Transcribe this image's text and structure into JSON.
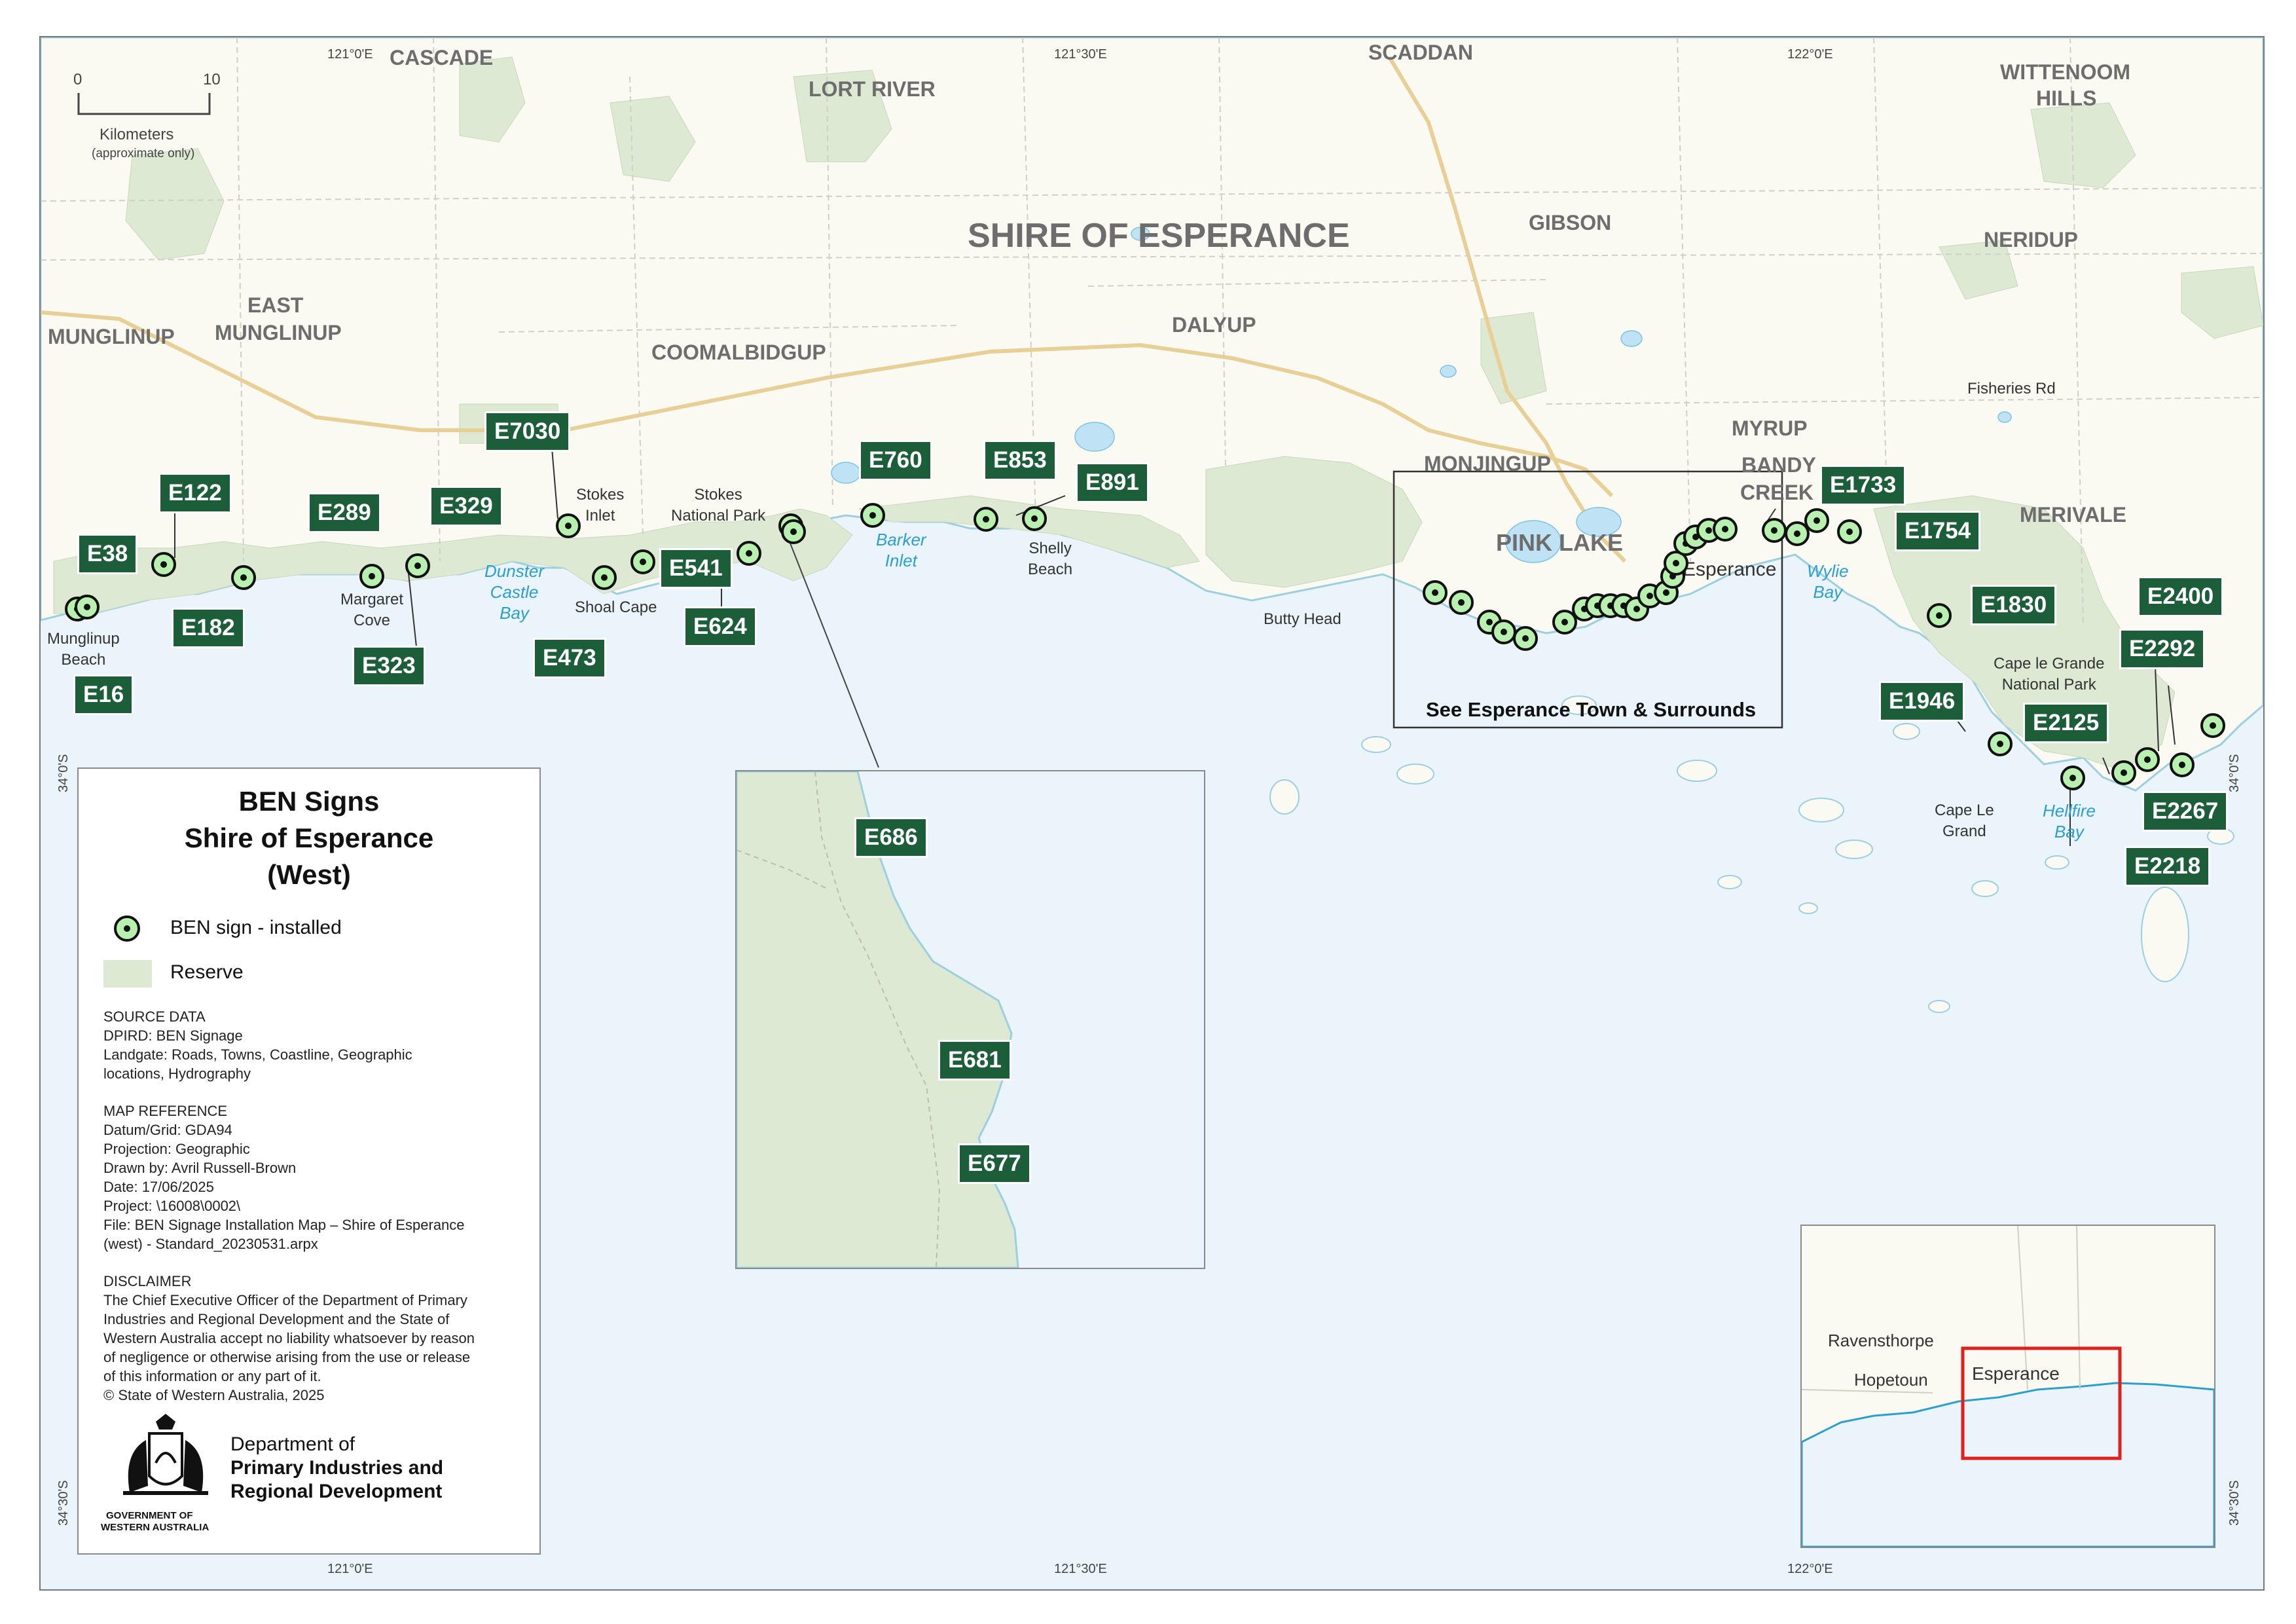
{
  "title": {
    "line1": "BEN Signs",
    "line2": "Shire of Esperance",
    "line3": "(West)"
  },
  "scale": {
    "zero": "0",
    "ten": "10",
    "unit": "Kilometers",
    "note": "(approximate only)"
  },
  "ticks": {
    "top": [
      "121°0'E",
      "121°30'E",
      "122°0'E"
    ],
    "bottom": [
      "121°0'E",
      "121°30'E",
      "122°0'E"
    ],
    "left": [
      "34°0'S",
      "34°30'S"
    ],
    "right": [
      "34°0'S",
      "34°30'S"
    ]
  },
  "legend": {
    "sign_label": "BEN sign - installed",
    "reserve_label": "Reserve",
    "source_heading": "SOURCE DATA",
    "source_lines": [
      "DPIRD: BEN Signage",
      "Landgate: Roads, Towns, Coastline, Geographic",
      "locations, Hydrography"
    ],
    "map_ref_heading": "MAP REFERENCE",
    "map_ref_lines": [
      "Datum/Grid: GDA94",
      "Projection:  Geographic",
      "Drawn by: Avril Russell-Brown",
      "Date: 17/06/2025",
      "Project: \\16008\\0002\\",
      "File: BEN Signage Installation Map – Shire of Esperance",
      "(west) - Standard_20230531.arpx"
    ],
    "disclaimer_heading": "DISCLAIMER",
    "disclaimer_lines": [
      "The Chief Executive Officer of the Department of Primary",
      "Industries and Regional Development and the State of",
      "Western Australia accept no liability whatsoever by reason",
      "of negligence or otherwise arising from the use or release",
      "of this information or any part of it.",
      "© State of Western Australia, 2025"
    ],
    "crest_line1": "GOVERNMENT OF",
    "crest_line2": "WESTERN AUSTRALIA",
    "dept_line1": "Department of",
    "dept_line2": "Primary Industries and",
    "dept_line3": "Regional Development"
  },
  "places": {
    "cascade": "CASCADE",
    "lort_river": "LORT RIVER",
    "scaddan": "SCADDAN",
    "wittenoom1": "WITTENOOM",
    "wittenoom2": "HILLS",
    "shire": "SHIRE OF ESPERANCE",
    "gibson": "GIBSON",
    "neridup": "NERIDUP",
    "east1": "EAST",
    "east2": "MUNGLINUP",
    "munglinup": "MUNGLINUP",
    "coomalbidgup": "COOMALBIDGUP",
    "dalyup": "DALYUP",
    "myrup": "MYRUP",
    "monjingup": "MONJINGUP",
    "bandy1": "BANDY",
    "bandy2": "CREEK",
    "merivale": "MERIVALE",
    "pink_lake": "PINK LAKE",
    "fisheries": "Fisheries Rd"
  },
  "localities": {
    "munglinup_beach1": "Munglinup",
    "munglinup_beach2": "Beach",
    "margaret1": "Margaret",
    "margaret2": "Cove",
    "stokes_inlet1": "Stokes",
    "stokes_inlet2": "Inlet",
    "stokes_np1": "Stokes",
    "stokes_np2": "National Park",
    "shoal_cape": "Shoal Cape",
    "shelly1": "Shelly",
    "shelly2": "Beach",
    "butty_head": "Butty Head",
    "esperance": "Esperance",
    "cape_le_grande_np1": "Cape le Grande",
    "cape_le_grande_np2": "National Park",
    "cape_le_grand1": "Cape Le",
    "cape_le_grand2": "Grand"
  },
  "water": {
    "dunster1": "Dunster",
    "dunster2": "Castle",
    "dunster3": "Bay",
    "barker1": "Barker",
    "barker2": "Inlet",
    "wylie1": "Wylie",
    "wylie2": "Bay",
    "hellfire1": "Hellfire",
    "hellfire2": "Bay"
  },
  "signs": [
    {
      "id": "E16",
      "label": "E16"
    },
    {
      "id": "E38",
      "label": "E38"
    },
    {
      "id": "E122",
      "label": "E122"
    },
    {
      "id": "E182",
      "label": "E182"
    },
    {
      "id": "E289",
      "label": "E289"
    },
    {
      "id": "E323",
      "label": "E323"
    },
    {
      "id": "E329",
      "label": "E329"
    },
    {
      "id": "E7030",
      "label": "E7030"
    },
    {
      "id": "E473",
      "label": "E473"
    },
    {
      "id": "E541",
      "label": "E541"
    },
    {
      "id": "E624",
      "label": "E624"
    },
    {
      "id": "E760",
      "label": "E760"
    },
    {
      "id": "E853",
      "label": "E853"
    },
    {
      "id": "E891",
      "label": "E891"
    },
    {
      "id": "E1733",
      "label": "E1733"
    },
    {
      "id": "E1754",
      "label": "E1754"
    },
    {
      "id": "E1830",
      "label": "E1830"
    },
    {
      "id": "E1946",
      "label": "E1946"
    },
    {
      "id": "E2125",
      "label": "E2125"
    },
    {
      "id": "E2400",
      "label": "E2400"
    },
    {
      "id": "E2292",
      "label": "E2292"
    },
    {
      "id": "E2267",
      "label": "E2267"
    },
    {
      "id": "E2218",
      "label": "E2218"
    },
    {
      "id": "E686",
      "label": "E686"
    },
    {
      "id": "E681",
      "label": "E681"
    },
    {
      "id": "E677",
      "label": "E677"
    }
  ],
  "esperance_inset_title": "See Esperance Town & Surrounds",
  "locator": {
    "ravensthorpe": "Ravensthorpe",
    "hopetoun": "Hopetoun",
    "esperance": "Esperance"
  },
  "colors": {
    "sea": "#eaf4fa",
    "land": "#fafaf3",
    "reserve": "#dde9d3",
    "sign_fill": "#b8f0b0",
    "label_bg": "#1d5e3a",
    "water_text": "#2a9fd0",
    "locator_box": "#e0201c"
  }
}
